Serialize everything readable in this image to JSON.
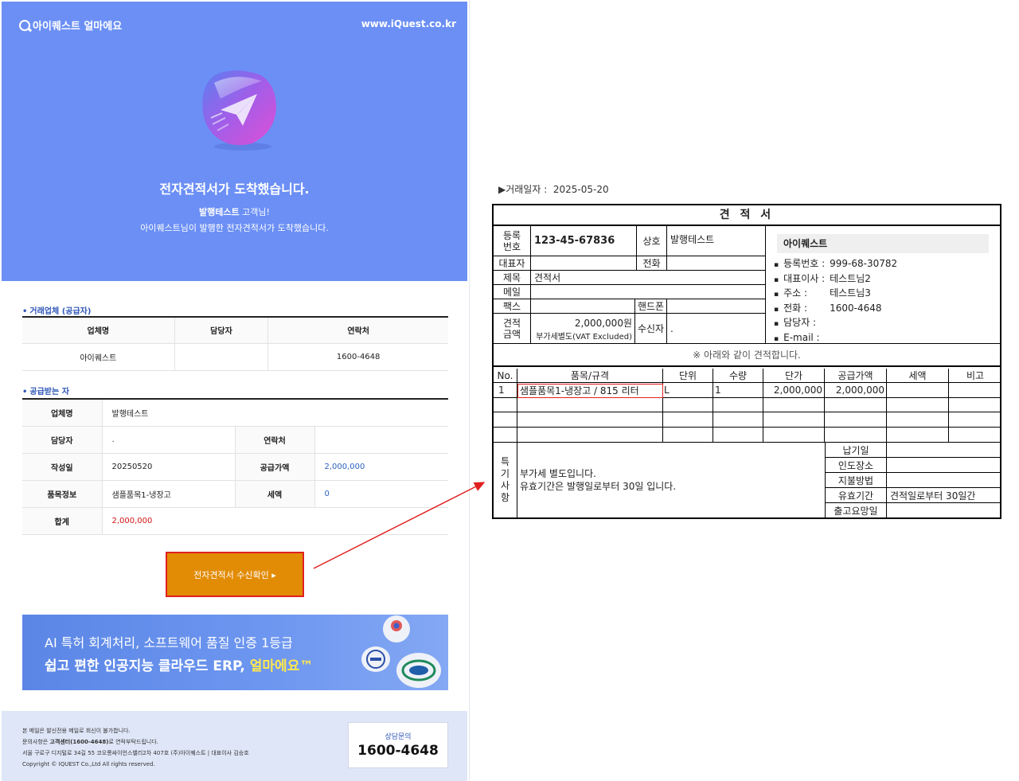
{
  "email": {
    "brand": "아이퀘스트 얼마에요",
    "site_url": "www.iQuest.co.kr",
    "hero_title": "전자견적서가 도착했습니다.",
    "hero_greeting_name": "발행테스트",
    "hero_greeting_suffix": " 고객님!",
    "hero_message": "아이퀘스트님이 발행한 전자견적서가 도착했습니다.",
    "supplier_section_title": "거래업체 (공급자)",
    "supplier_headers": [
      "업체명",
      "담당자",
      "연락처"
    ],
    "supplier_values": [
      "아이퀘스트",
      "",
      "1600-4648"
    ],
    "receiver_section_title": "공급받는 자",
    "receiver": {
      "company_label": "업체명",
      "company_value": "발행테스트",
      "manager_label": "담당자",
      "manager_value": ".",
      "contact_label": "연락처",
      "contact_value": "",
      "date_label": "작성일",
      "date_value": "20250520",
      "supply_label": "공급가액",
      "supply_value": "2,000,000",
      "item_label": "품목정보",
      "item_value": "샘플품목1-냉장고",
      "tax_label": "세액",
      "tax_value": "0",
      "total_label": "합계",
      "total_value": "2,000,000"
    },
    "confirm_button": "전자견적서 수신확인 ▸",
    "banner_line1": "AI 특허 회계처리, 소프트웨어 품질 인증 1등급",
    "banner_line2_prefix": "쉽고 편한 인공지능 클라우드 ERP, ",
    "banner_line2_brand": "얼마에요™",
    "footer_line1": "본 메일은 발신전용 메일로 회신이 불가합니다.",
    "footer_line2_prefix": "문의사항은 ",
    "footer_line2_bold": "고객센터(1600-4648)",
    "footer_line2_suffix": "로 연락부탁드립니다.",
    "footer_line3": "서울 구로구 디지털로 34길 55 코오롱싸이언스밸리2차 407호 (주)아이퀘스트 | 대표이사 김승호",
    "footer_line4": "Copyright © IQUEST Co.,Ltd All rights reserved.",
    "contact_label": "상담문의",
    "contact_number": "1600-4648"
  },
  "quote": {
    "trade_date_label": "▶거래일자 :",
    "trade_date": "2025-05-20",
    "title": "견 적 서",
    "reg_label": "등록번호",
    "reg_value": "123-45-67836",
    "name_label": "상호",
    "name_value": "발행테스트",
    "ceo_label": "대표자",
    "phone_label": "전화",
    "subject_label": "제목",
    "subject_value": "견적서",
    "mail_label": "메일",
    "fax_label": "팩스",
    "mobile_label": "핸드폰",
    "amount_label": "견적금액",
    "amount_value": "2,000,000원",
    "amount_note": "부가세별도(VAT Excluded)",
    "receiver_label": "수신자",
    "receiver_value": ".",
    "supplier_name": "아이퀘스트",
    "supplier_info": [
      {
        "k": "등록번호 :",
        "v": "999-68-30782"
      },
      {
        "k": "대표이사 :",
        "v": "테스트님2"
      },
      {
        "k": "주소 :",
        "v": "테스트님3"
      },
      {
        "k": "전화 :",
        "v": "1600-4648"
      },
      {
        "k": "담당자 :",
        "v": ""
      },
      {
        "k": "E-mail :",
        "v": ""
      }
    ],
    "note": "※ 아래와 같이 견적합니다.",
    "item_headers": [
      "No.",
      "품목/규격",
      "단위",
      "수량",
      "단가",
      "공급가액",
      "세액",
      "비고"
    ],
    "items": [
      {
        "no": "1",
        "name": "샘플품목1-냉장고 / 815 리터",
        "unit": "L",
        "qty": "1",
        "price": "2,000,000",
        "supply": "2,000,000",
        "tax": "",
        "memo": ""
      }
    ],
    "remarks_label": "특기사항",
    "remarks_line1": "부가세 별도입니다.",
    "remarks_line2": "유효기간은 발행일로부터 30일 입니다.",
    "terms": [
      {
        "k": "납기일",
        "v": ""
      },
      {
        "k": "인도장소",
        "v": ""
      },
      {
        "k": "지불방법",
        "v": ""
      },
      {
        "k": "유효기간",
        "v": "견적일로부터 30일간"
      },
      {
        "k": "출고요망일",
        "v": ""
      }
    ]
  },
  "colors": {
    "hero_blue": "#6b8ff5",
    "button_orange": "#e28c06",
    "highlight_red": "#e02020",
    "accent_blue": "#2b61c0",
    "total_red": "#d11616"
  },
  "icons": [
    "search-q-logo-icon",
    "paper-plane-icon",
    "patent-office-badge-icon",
    "nipa-badge-icon",
    "good-software-badge-icon"
  ]
}
